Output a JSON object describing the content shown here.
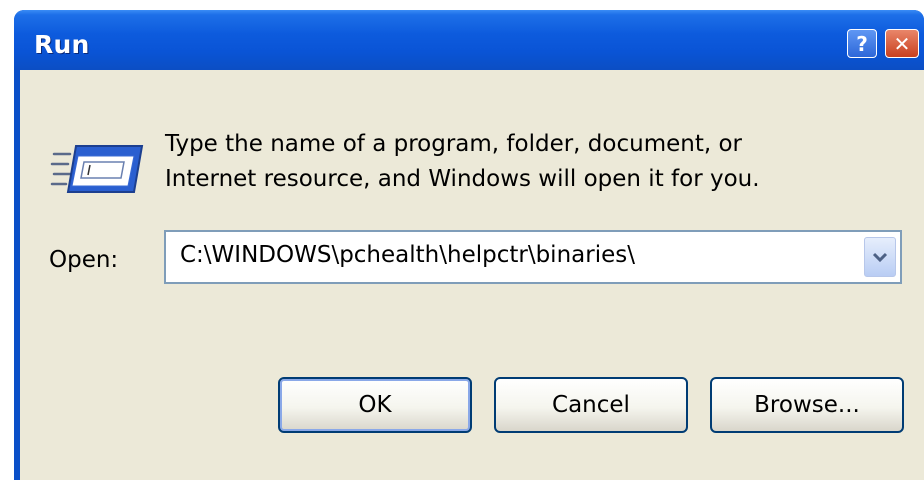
{
  "window": {
    "title": "Run",
    "help_glyph": "?",
    "close_glyph": "✕"
  },
  "dialog": {
    "description_line1": "Type the name of a program, folder, document, or",
    "description_line2": "Internet resource, and Windows will open it for you.",
    "open_label": "Open:",
    "open_value": "C:\\WINDOWS\\pchealth\\helpctr\\binaries\\"
  },
  "buttons": {
    "ok": "OK",
    "cancel": "Cancel",
    "browse": "Browse..."
  },
  "icons": {
    "run": "run-program-icon",
    "dropdown": "chevron-down-icon",
    "help": "help-icon",
    "close": "close-icon"
  },
  "colors": {
    "titlebar": "#0a54d6",
    "dialog_bg": "#ece9d8",
    "input_border": "#7f9db9",
    "button_border": "#003c74"
  }
}
